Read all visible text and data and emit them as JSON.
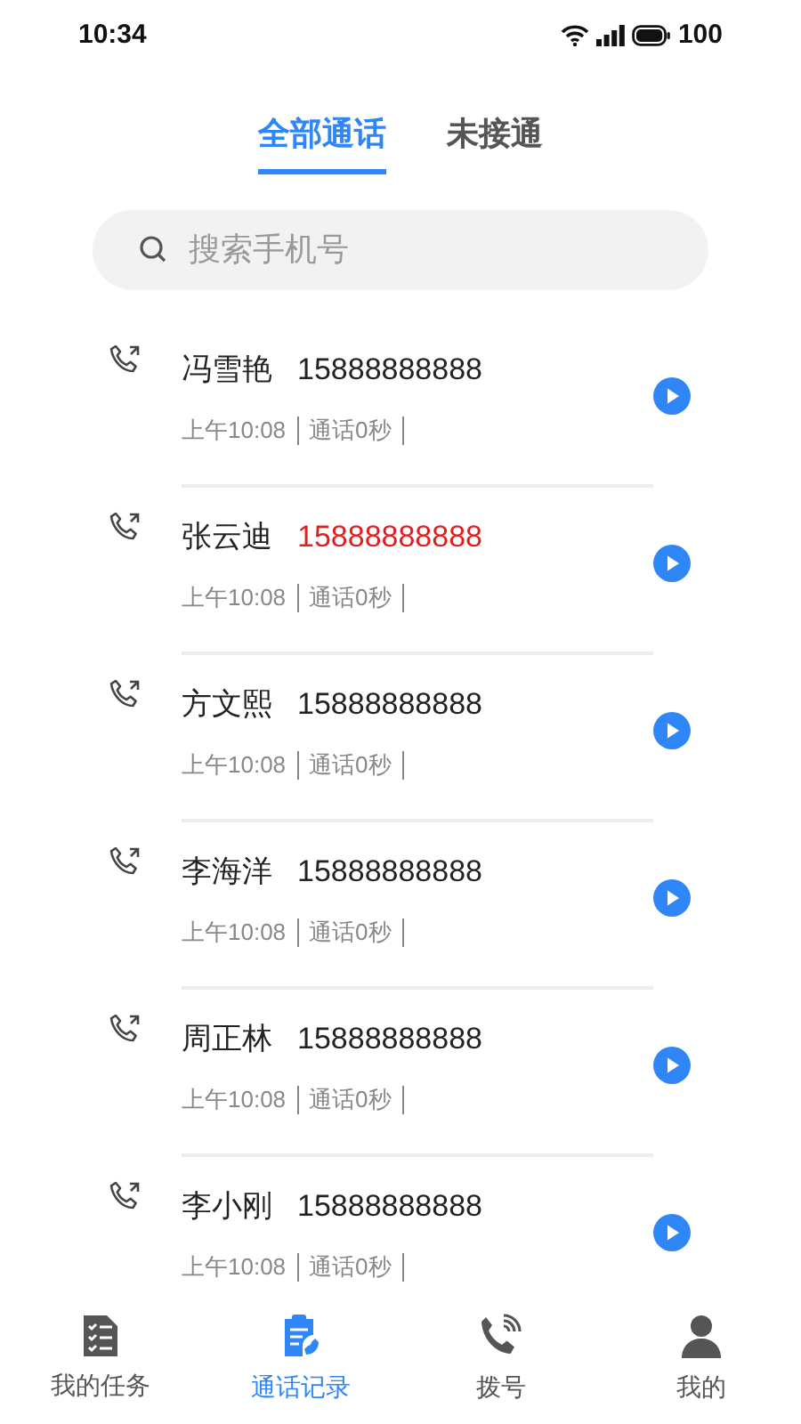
{
  "status_bar": {
    "time": "10:34",
    "battery": "100"
  },
  "tabs": [
    {
      "label": "全部通话",
      "selected": true
    },
    {
      "label": "未接通",
      "selected": false
    }
  ],
  "search": {
    "placeholder": "搜索手机号"
  },
  "calls": [
    {
      "name": "冯雪艳",
      "number": "15888888888",
      "color": "#222222",
      "time": "上午10:08",
      "duration": "通话0秒"
    },
    {
      "name": "张云迪",
      "number": "15888888888",
      "color": "#e02020",
      "time": "上午10:08",
      "duration": "通话0秒"
    },
    {
      "name": "方文熙",
      "number": "15888888888",
      "color": "#222222",
      "time": "上午10:08",
      "duration": "通话0秒"
    },
    {
      "name": "李海洋",
      "number": "15888888888",
      "color": "#222222",
      "time": "上午10:08",
      "duration": "通话0秒"
    },
    {
      "name": "周正林",
      "number": "15888888888",
      "color": "#222222",
      "time": "上午10:08",
      "duration": "通话0秒"
    },
    {
      "name": "李小刚",
      "number": "15888888888",
      "color": "#222222",
      "time": "上午10:08",
      "duration": "通话0秒"
    }
  ],
  "bottom_nav": [
    {
      "kind": "tasks",
      "label": "我的任务",
      "selected": false
    },
    {
      "kind": "records",
      "label": "通话记录",
      "selected": true
    },
    {
      "kind": "dial",
      "label": "拨号",
      "selected": false
    },
    {
      "kind": "me",
      "label": "我的",
      "selected": false
    }
  ]
}
